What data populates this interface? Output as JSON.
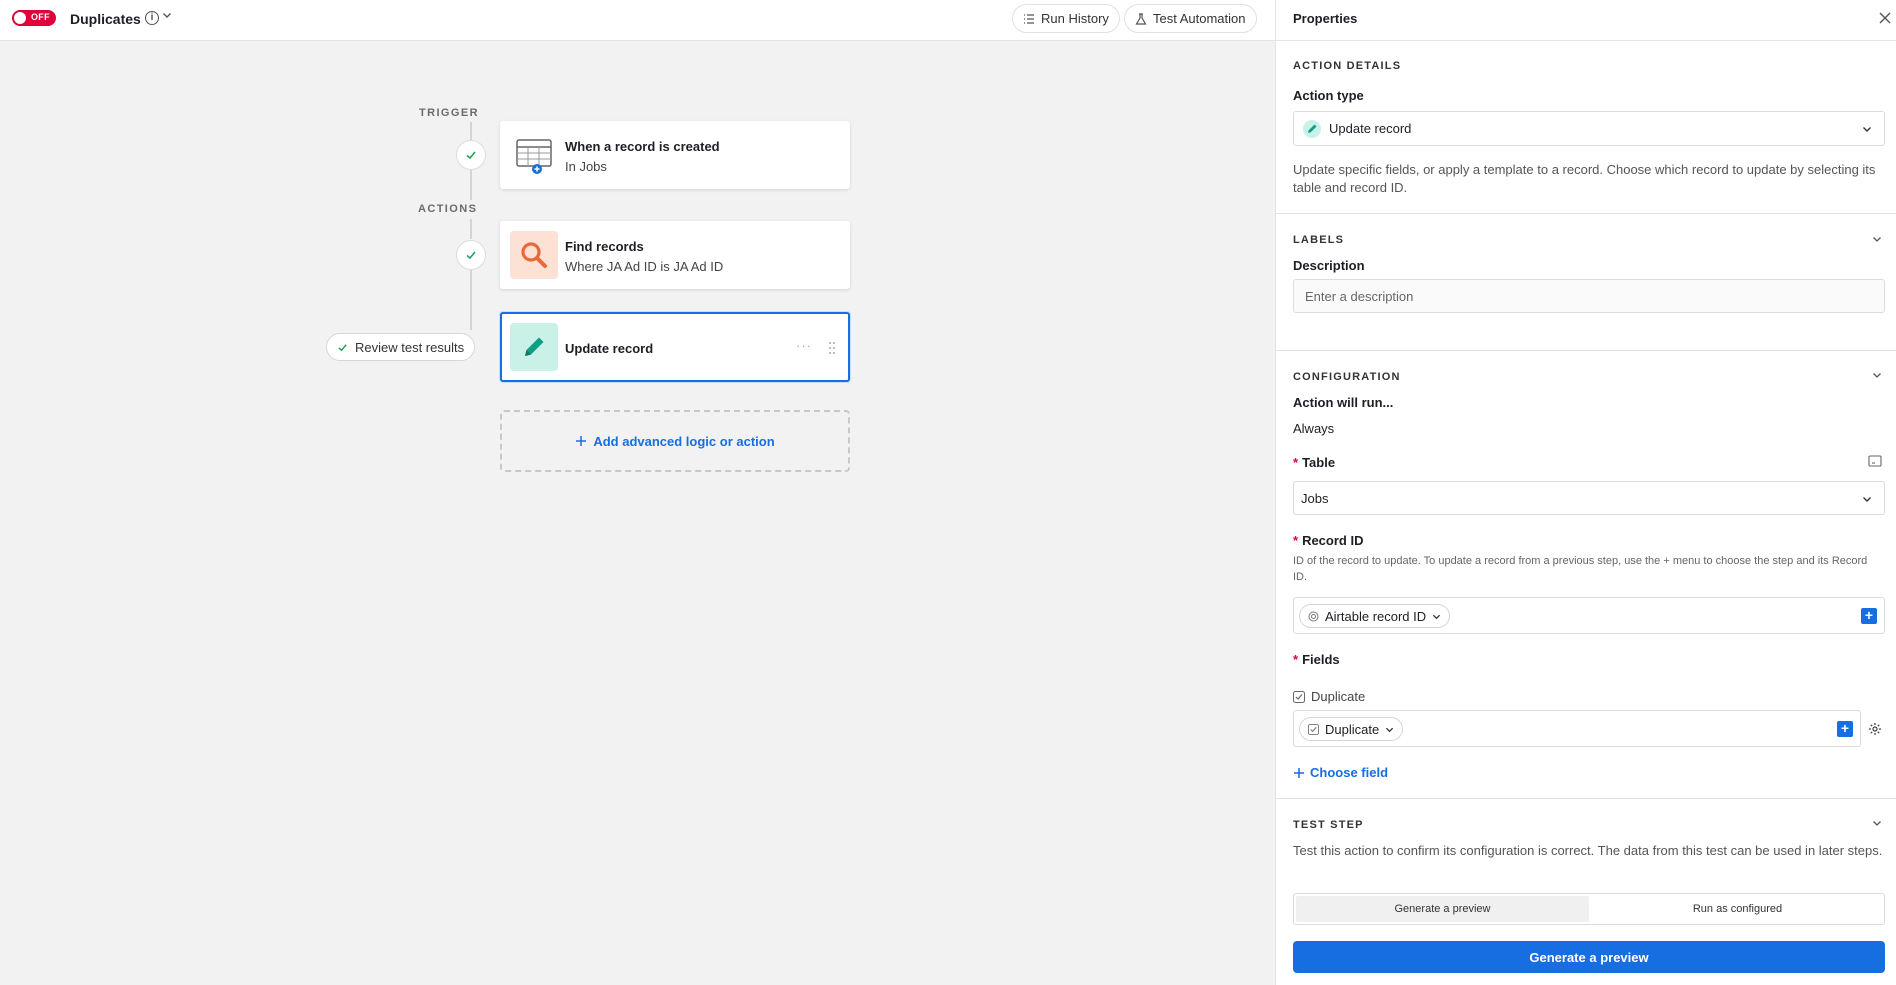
{
  "topbar": {
    "toggle_label": "OFF",
    "automation_name": "Duplicates",
    "run_history_label": "Run History",
    "test_automation_label": "Test Automation"
  },
  "canvas": {
    "trigger_label": "TRIGGER",
    "actions_label": "ACTIONS",
    "trigger_node": {
      "title": "When a record is created",
      "subtitle": "In Jobs"
    },
    "find_node": {
      "title": "Find records",
      "subtitle": "Where JA Ad ID is JA Ad ID"
    },
    "update_node": {
      "title": "Update record",
      "dots": "···"
    },
    "review_label": "Review test results",
    "add_label": "Add advanced logic or action"
  },
  "panel": {
    "title": "Properties",
    "action_details": {
      "section": "ACTION DETAILS",
      "action_type_label": "Action type",
      "action_type_value": "Update record",
      "description": "Update specific fields, or apply a template to a record. Choose which record to update by selecting its table and record ID."
    },
    "labels": {
      "section": "LABELS",
      "description_label": "Description",
      "description_placeholder": "Enter a description"
    },
    "configuration": {
      "section": "CONFIGURATION",
      "run_label": "Action will run...",
      "run_value": "Always",
      "table_label": "Table",
      "table_value": "Jobs",
      "record_id_label": "Record ID",
      "record_id_help": "ID of the record to update. To update a record from a previous step, use the + menu to choose the step and its Record ID.",
      "record_id_pill": "Airtable record ID",
      "fields_label": "Fields",
      "field_name": "Duplicate",
      "field_pill": "Duplicate",
      "choose_field": "Choose field"
    },
    "test_step": {
      "section": "TEST STEP",
      "description": "Test this action to confirm its configuration is correct. The data from this test can be used in later steps.",
      "tab_preview": "Generate a preview",
      "tab_run": "Run as configured",
      "primary_button": "Generate a preview"
    }
  },
  "colors": {
    "accent": "#166ee1",
    "off_toggle": "#dc043b",
    "find_icon_bg": "#fde1d4",
    "find_icon_fg": "#e8683a",
    "update_icon_bg": "#c9f1e7",
    "update_icon_fg": "#0f9e83"
  },
  "icons": [
    "table-plus-icon",
    "search-icon",
    "pencil-icon",
    "check-icon",
    "gear-icon",
    "close-icon",
    "chevron-down-icon",
    "info-icon",
    "flask-icon",
    "list-icon"
  ]
}
